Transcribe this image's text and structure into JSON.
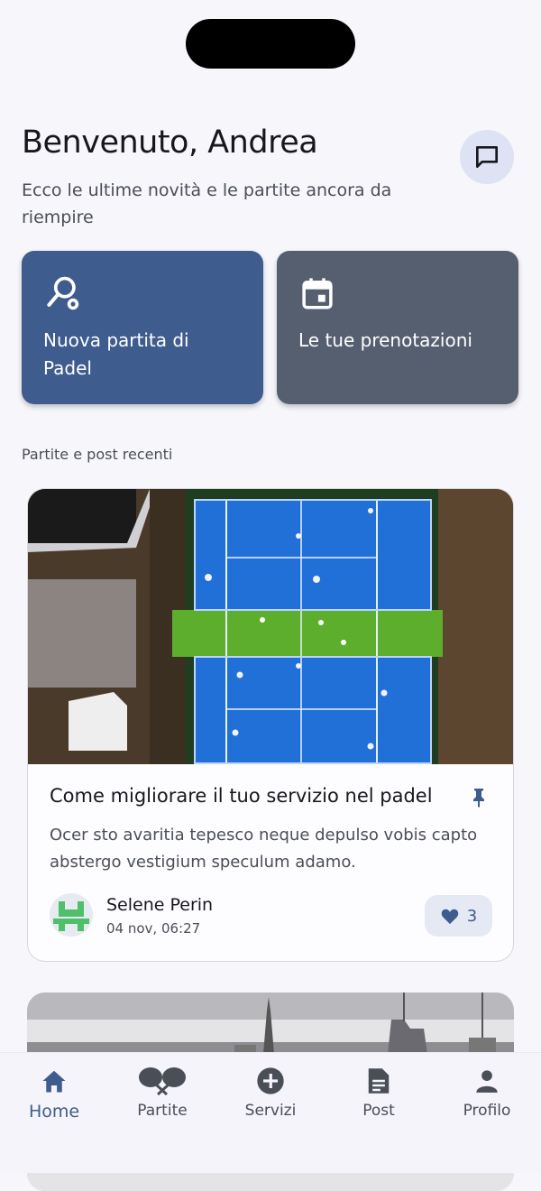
{
  "header": {
    "title": "Benvenuto, Andrea",
    "subtitle": "Ecco le ultime novità e le partite ancora da riempire",
    "chat_icon": "chat-bubble-icon"
  },
  "actions": [
    {
      "label": "Nuova partita di Padel",
      "icon": "padel-racket-icon",
      "color": "#3f5c8e"
    },
    {
      "label": "Le tue prenotazioni",
      "icon": "calendar-icon",
      "color": "#565f70"
    }
  ],
  "feed": {
    "section_label": "Partite e post recenti",
    "posts": [
      {
        "title": "Come migliorare il tuo servizio nel padel",
        "text": "Ocer sto avaritia tepesco neque depulso vobis capto abstergo vestigium speculum adamo.",
        "author": "Selene Perin",
        "date": "04 nov, 06:27",
        "likes": "3",
        "pinned": true
      }
    ]
  },
  "tabbar": {
    "items": [
      {
        "label": "Home",
        "icon": "home-icon",
        "active": true
      },
      {
        "label": "Partite",
        "icon": "padel-rackets-icon",
        "active": false
      },
      {
        "label": "Servizi",
        "icon": "plus-circle-icon",
        "active": false
      },
      {
        "label": "Post",
        "icon": "document-icon",
        "active": false
      },
      {
        "label": "Profilo",
        "icon": "person-icon",
        "active": false
      }
    ]
  },
  "colors": {
    "primary": "#3f5c8e",
    "secondary": "#565f70",
    "background": "#f6f6fb"
  }
}
